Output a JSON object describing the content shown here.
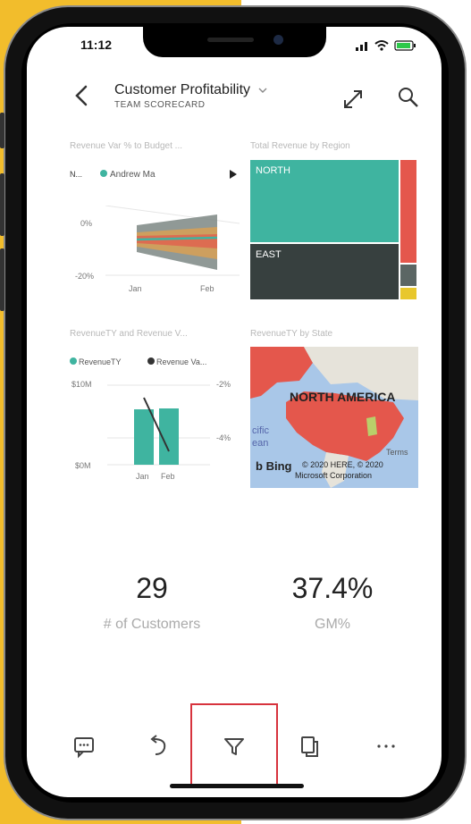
{
  "status_bar": {
    "time": "11:12"
  },
  "header": {
    "title": "Customer Profitability",
    "subtitle": "TEAM SCORECARD"
  },
  "tiles": {
    "revenue_var_budget": {
      "title": "Revenue Var % to Budget ...",
      "legend_prefix": "N...",
      "legend_item": "Andrew Ma",
      "y_ticks": [
        "0%",
        "-20%"
      ],
      "x_ticks": [
        "Jan",
        "Feb"
      ]
    },
    "revenue_by_region": {
      "title": "Total Revenue by Region",
      "regions": [
        "NORTH",
        "EAST"
      ]
    },
    "revenue_ty_var": {
      "title": "RevenueTY and Revenue V...",
      "legend": [
        "RevenueTY",
        "Revenue Va..."
      ],
      "y_left": [
        "$10M",
        "$0M"
      ],
      "y_right": [
        "-2%",
        "-4%"
      ],
      "x_ticks": [
        "Jan",
        "Feb"
      ]
    },
    "revenue_by_state": {
      "title": "RevenueTY by State",
      "map_label": "NORTH AMERICA",
      "ocean_label_1": "cific",
      "ocean_label_2": "ean",
      "brand": "Bing",
      "copyright_1": "© 2020 HERE, © 2020",
      "copyright_2": "Microsoft Corporation",
      "terms": "Terms"
    }
  },
  "kpis": [
    {
      "value": "29",
      "label": "# of Customers"
    },
    {
      "value": "37.4%",
      "label": "GM%"
    }
  ],
  "colors": {
    "teal": "#3fb4a0",
    "dark": "#37403f",
    "red": "#e4574c",
    "highlight": "#d7333d",
    "frame_yellow": "#f2bd2c"
  },
  "icons": {
    "comment": "comment-icon",
    "undo": "undo-icon",
    "filter": "filter-icon",
    "copy": "copy-icon",
    "more": "more-icon"
  }
}
